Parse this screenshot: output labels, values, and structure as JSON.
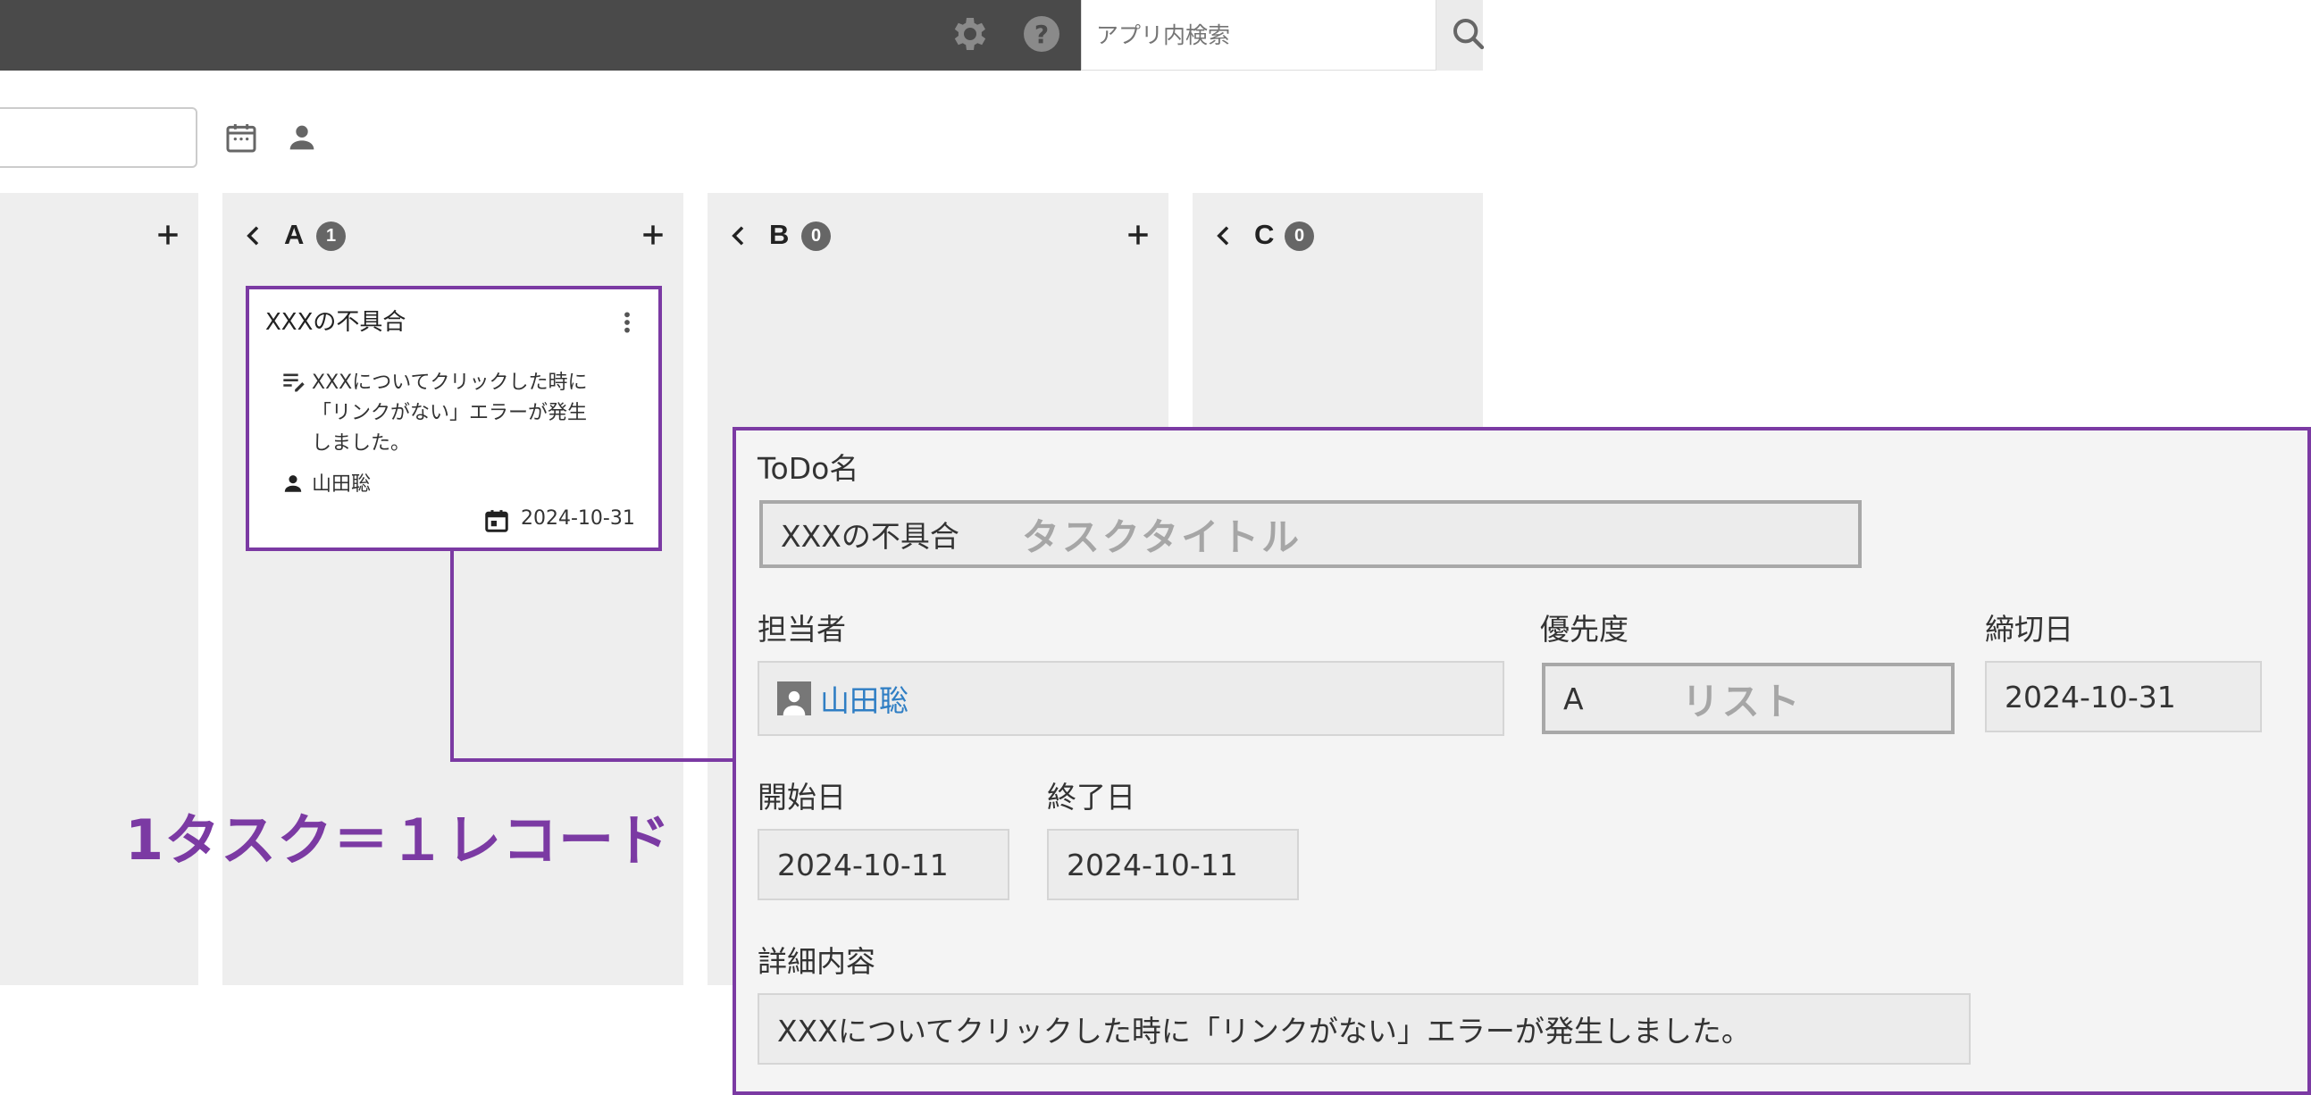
{
  "header": {
    "search_placeholder": "アプリ内検索",
    "icons": [
      "gear-icon",
      "help-icon",
      "search-icon"
    ]
  },
  "toolbar": {
    "icons": [
      "calendar-icon",
      "person-icon"
    ]
  },
  "columns": [
    {
      "name": "",
      "count": ""
    },
    {
      "name": "A",
      "count": "1"
    },
    {
      "name": "B",
      "count": "0"
    },
    {
      "name": "C",
      "count": "0"
    }
  ],
  "card": {
    "title": "XXXの不具合",
    "description_lines": [
      "XXXについてクリックした時に",
      "「リンクがない」エラーが発生",
      "しました。"
    ],
    "assignee": "山田聡",
    "due": "2024-10-31"
  },
  "caption": "1タスク＝１レコード",
  "form": {
    "todo_label": "ToDo名",
    "todo_value": "XXXの不具合",
    "todo_hint": "タスクタイトル",
    "assignee_label": "担当者",
    "assignee_value": "山田聡",
    "priority_label": "優先度",
    "priority_value": "A",
    "priority_hint": "リスト",
    "deadline_label": "締切日",
    "deadline_value": "2024-10-31",
    "start_label": "開始日",
    "start_value": "2024-10-11",
    "end_label": "終了日",
    "end_value": "2024-10-11",
    "detail_label": "詳細内容",
    "detail_value": "XXXについてクリックした時に「リンクがない」エラーが発生しました。"
  },
  "colors": {
    "accent": "#7b3aa3",
    "link": "#2f7ec4",
    "header": "#4a4a4a"
  }
}
